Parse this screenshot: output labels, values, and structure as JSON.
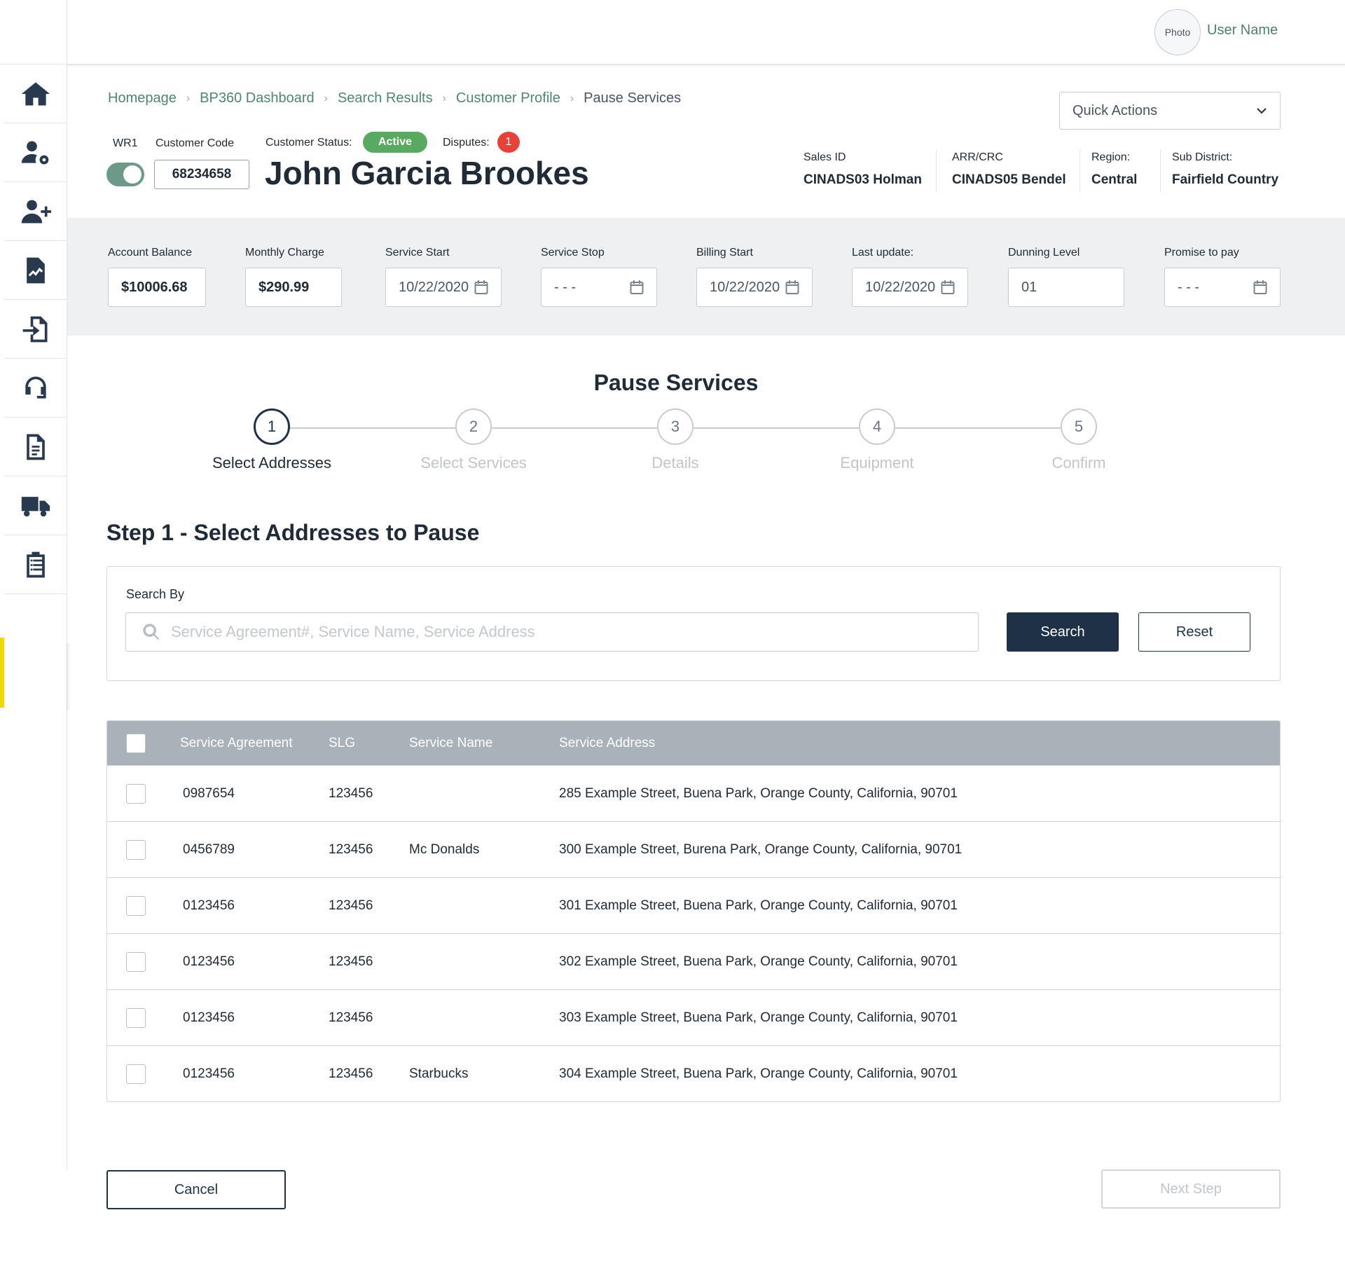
{
  "topbar": {
    "avatar_text": "Photo",
    "user_name": "User Name"
  },
  "sidebar": {
    "items": [
      {
        "icon": "home-icon"
      },
      {
        "icon": "user-settings-icon"
      },
      {
        "icon": "add-user-icon"
      },
      {
        "icon": "report-icon"
      },
      {
        "icon": "import-icon"
      },
      {
        "icon": "headset-icon"
      },
      {
        "icon": "document-icon"
      },
      {
        "icon": "truck-icon"
      },
      {
        "icon": "clipboard-list-icon"
      }
    ]
  },
  "breadcrumb": {
    "items": [
      "Homepage",
      "BP360 Dashboard",
      "Search Results",
      "Customer Profile"
    ],
    "current": "Pause Services"
  },
  "quick_actions": {
    "label": "Quick Actions"
  },
  "customer": {
    "wr_label": "WR1",
    "code_label": "Customer Code",
    "code": "68234658",
    "status_label": "Customer Status:",
    "status": "Active",
    "disputes_label": "Disputes:",
    "disputes_count": "1",
    "name": "John Garcia Brookes",
    "toggle_on": true
  },
  "meta": {
    "sales_id_label": "Sales ID",
    "sales_id": "CINADS03 Holman",
    "arr_label": "ARR/CRC",
    "arr": "CINADS05 Bendel",
    "region_label": "Region:",
    "region": "Central",
    "subdistrict_label": "Sub District:",
    "subdistrict": "Fairfield Country"
  },
  "account": {
    "balance_label": "Account Balance",
    "balance": "$10006.68",
    "monthly_label": "Monthly Charge",
    "monthly": "$290.99",
    "service_start_label": "Service Start",
    "service_start": "10/22/2020",
    "service_stop_label": "Service Stop",
    "service_stop": "- - -",
    "billing_start_label": "Billing Start",
    "billing_start": "10/22/2020",
    "last_update_label": "Last update:",
    "last_update": "10/22/2020",
    "dunning_label": "Dunning Level",
    "dunning": "01",
    "promise_label": "Promise to pay",
    "promise": "- - -"
  },
  "page": {
    "title": "Pause Services",
    "step_heading": "Step 1 - Select Addresses to Pause"
  },
  "steps": [
    {
      "num": "1",
      "label": "Select Addresses",
      "active": true
    },
    {
      "num": "2",
      "label": "Select Services",
      "active": false
    },
    {
      "num": "3",
      "label": "Details",
      "active": false
    },
    {
      "num": "4",
      "label": "Equipment",
      "active": false
    },
    {
      "num": "5",
      "label": "Confirm",
      "active": false
    }
  ],
  "search": {
    "label": "Search By",
    "placeholder": "Service Agreement#, Service Name, Service Address",
    "search_button": "Search",
    "reset_button": "Reset"
  },
  "table": {
    "headers": [
      "Service Agreement",
      "SLG",
      "Service Name",
      "Service Address"
    ],
    "rows": [
      {
        "agreement": "0987654",
        "slg": "123456",
        "name": "",
        "address": "285 Example Street, Buena Park, Orange County, California, 90701"
      },
      {
        "agreement": "0456789",
        "slg": "123456",
        "name": "Mc Donalds",
        "address": "300 Example Street, Burena Park, Orange County, California, 90701"
      },
      {
        "agreement": "0123456",
        "slg": "123456",
        "name": "",
        "address": "301 Example Street, Buena Park, Orange County, California, 90701"
      },
      {
        "agreement": "0123456",
        "slg": "123456",
        "name": "",
        "address": "302 Example Street, Buena Park, Orange County, California, 90701"
      },
      {
        "agreement": "0123456",
        "slg": "123456",
        "name": "",
        "address": "303 Example Street, Buena Park, Orange County, California, 90701"
      },
      {
        "agreement": "0123456",
        "slg": "123456",
        "name": "Starbucks",
        "address": "304 Example Street, Buena Park, Orange County, California, 90701"
      }
    ]
  },
  "footer": {
    "cancel_button": "Cancel",
    "next_button": "Next Step"
  },
  "colors": {
    "primary": "#1f3147",
    "accent_green": "#4f8573",
    "status_active": "#59a961",
    "dispute_red": "#e8413a",
    "table_header": "#a9b1b9"
  }
}
